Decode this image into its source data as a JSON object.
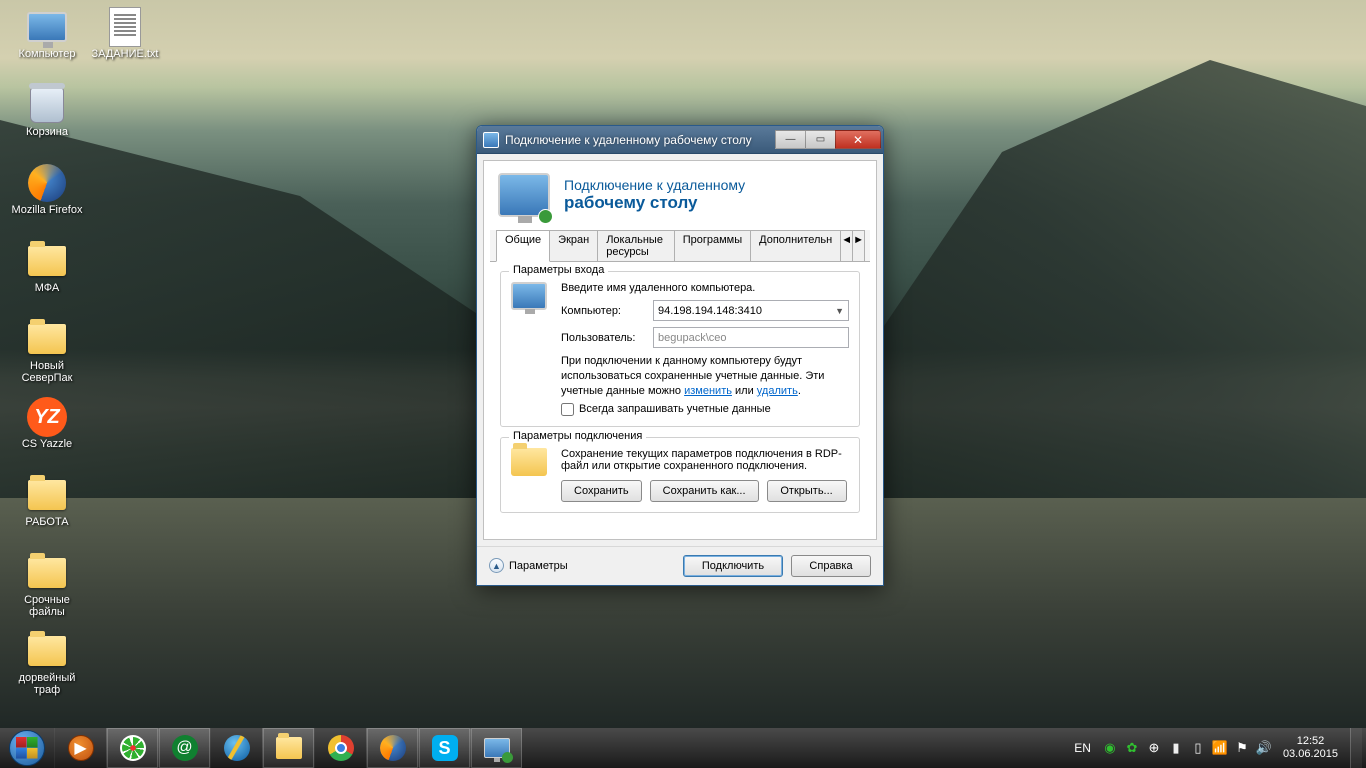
{
  "desktop_icons": [
    {
      "name": "computer",
      "label": "Компьютер"
    },
    {
      "name": "recycle-bin",
      "label": "Корзина"
    },
    {
      "name": "firefox",
      "label": "Mozilla Firefox"
    },
    {
      "name": "mfa",
      "label": "МФА"
    },
    {
      "name": "novy-severpak",
      "label": "Новый СеверПак"
    },
    {
      "name": "cs-yazzle",
      "label": "CS Yazzle"
    },
    {
      "name": "rabota",
      "label": "РАБОТА"
    },
    {
      "name": "srochnye",
      "label": "Срочные файлы"
    },
    {
      "name": "dorveyny",
      "label": "дорвейный траф"
    },
    {
      "name": "zadanie",
      "label": "ЗАДАНИЕ.txt"
    }
  ],
  "rdp": {
    "title": "Подключение к удаленному рабочему столу",
    "header_line1": "Подключение к удаленному",
    "header_line2": "рабочему столу",
    "tabs": {
      "general": "Общие",
      "screen": "Экран",
      "local": "Локальные ресурсы",
      "programs": "Программы",
      "advanced": "Дополнительн",
      "nav_left": "◄",
      "nav_right": "►"
    },
    "group_login": {
      "title": "Параметры входа",
      "intro": "Введите имя удаленного компьютера.",
      "computer_label": "Компьютер:",
      "computer_value": "94.198.194.148:3410",
      "user_label": "Пользователь:",
      "user_value": "begupack\\ceo",
      "note_prefix": "При подключении к данному компьютеру будут использоваться сохраненные учетные данные. Эти учетные данные можно ",
      "note_link1": "изменить",
      "note_mid": " или ",
      "note_link2": "удалить",
      "note_suffix": ".",
      "checkbox": "Всегда запрашивать учетные данные"
    },
    "group_conn": {
      "title": "Параметры подключения",
      "desc": "Сохранение текущих параметров подключения в RDP-файл или открытие сохраненного подключения.",
      "save": "Сохранить",
      "save_as": "Сохранить как...",
      "open": "Открыть..."
    },
    "footer": {
      "options": "Параметры",
      "connect": "Подключить",
      "help": "Справка"
    }
  },
  "taskbar": {
    "lang": "EN",
    "time": "12:52",
    "date": "03.06.2015"
  }
}
